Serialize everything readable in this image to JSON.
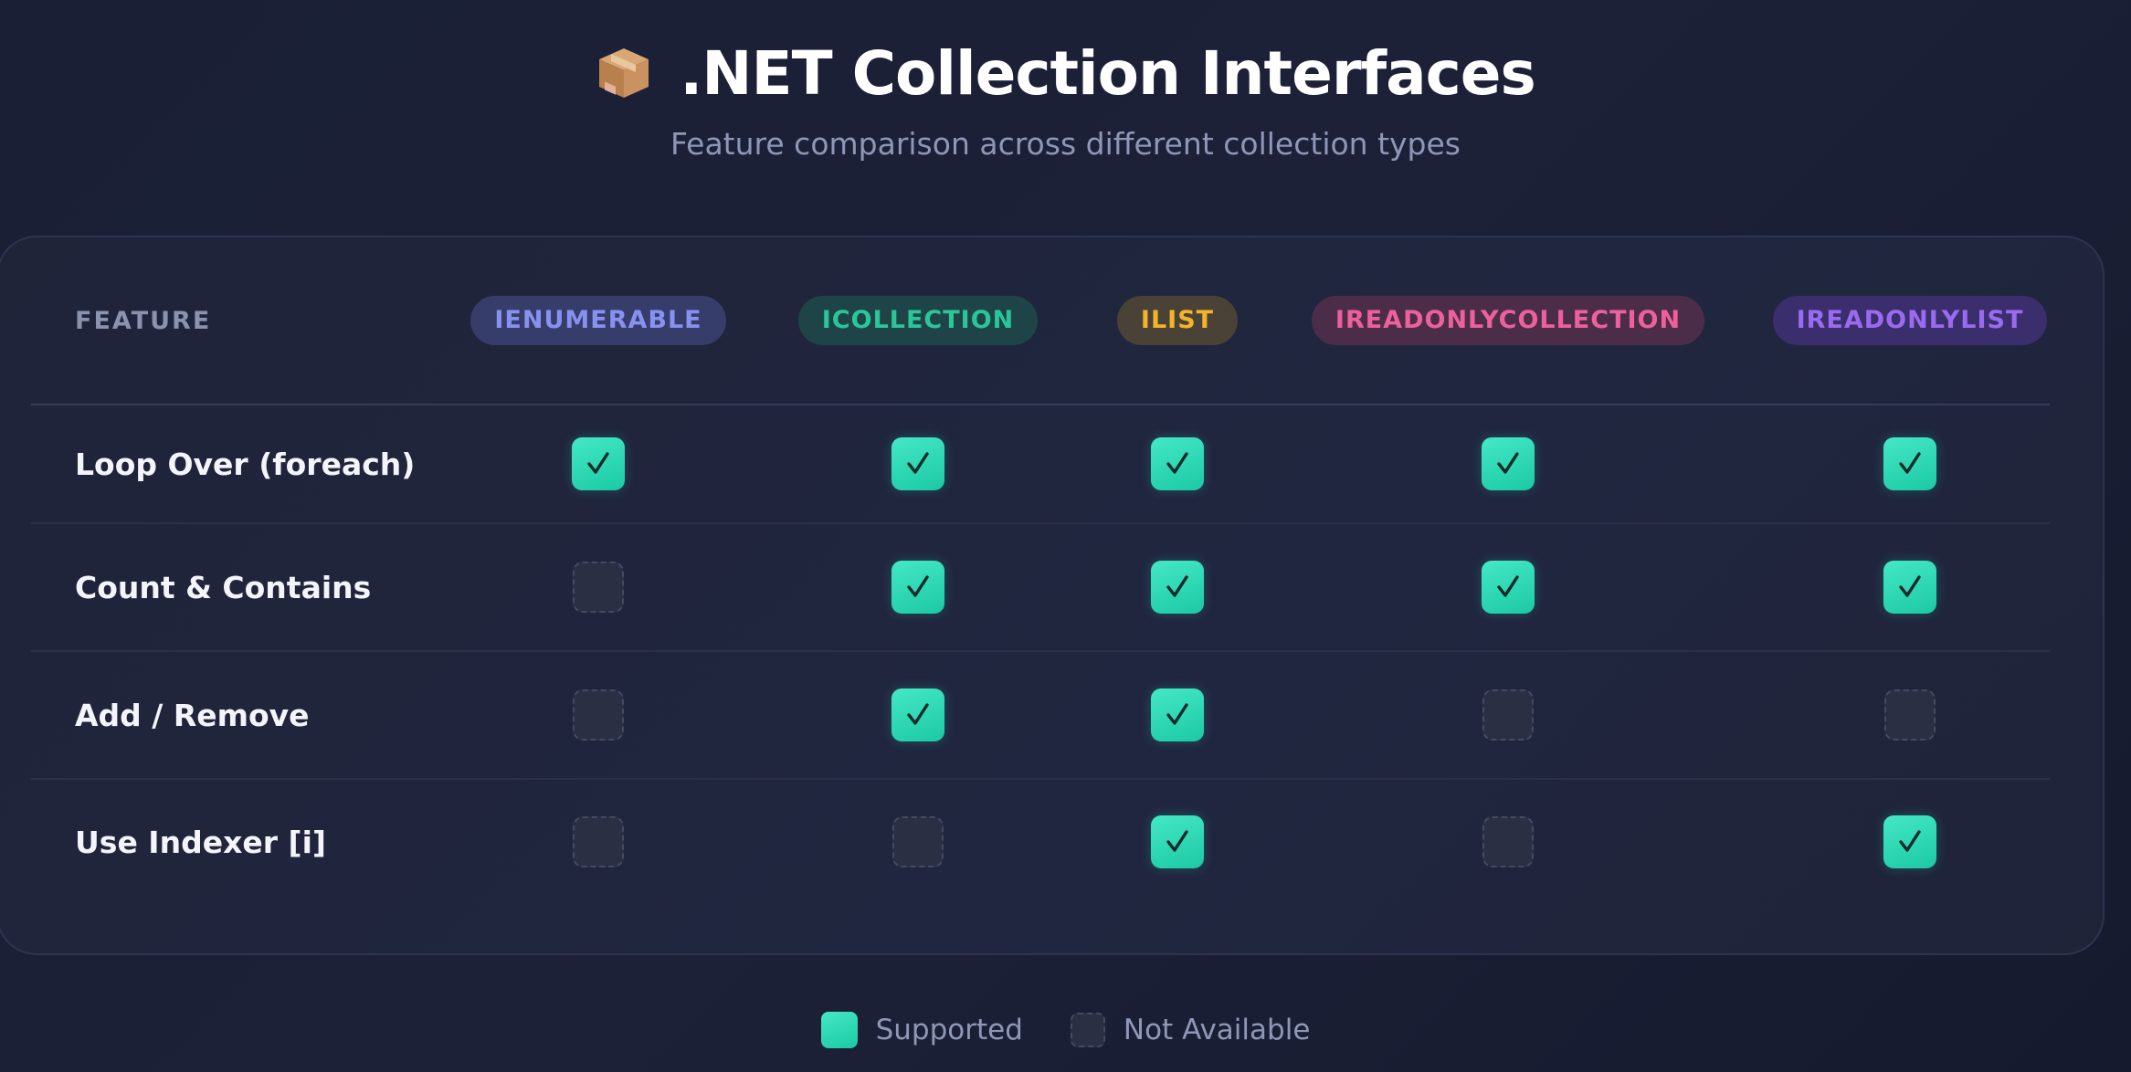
{
  "header": {
    "icon": "package-icon",
    "title": ".NET Collection Interfaces",
    "subtitle": "Feature comparison across different collection types"
  },
  "table": {
    "feature_header": "FEATURE",
    "columns": [
      {
        "label": "IENUMERABLE",
        "color": "#8791ef"
      },
      {
        "label": "ICOLLECTION",
        "color": "#2ac69a"
      },
      {
        "label": "ILIST",
        "color": "#f4b42a"
      },
      {
        "label": "IREADONLYCOLLECTION",
        "color": "#ee5f9d"
      },
      {
        "label": "IREADONLYLIST",
        "color": "#9a6af0"
      }
    ],
    "rows": [
      {
        "feature": "Loop Over (foreach)",
        "support": [
          true,
          true,
          true,
          true,
          true
        ]
      },
      {
        "feature": "Count & Contains",
        "support": [
          false,
          true,
          true,
          true,
          true
        ]
      },
      {
        "feature": "Add / Remove",
        "support": [
          false,
          true,
          true,
          false,
          false
        ]
      },
      {
        "feature": "Use Indexer [i]",
        "support": [
          false,
          false,
          true,
          false,
          true
        ]
      }
    ],
    "check_glyph": "✓"
  },
  "legend": {
    "supported": "Supported",
    "not_available": "Not Available"
  },
  "colors": {
    "supported_accent": "#2dd4b0",
    "background": "#1a1f35"
  }
}
